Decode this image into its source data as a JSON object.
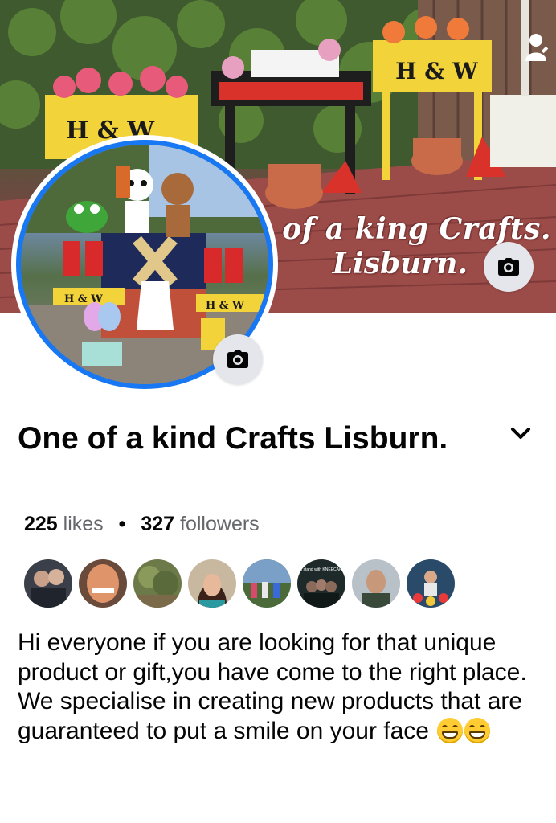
{
  "cover": {
    "sign_text": "H & W",
    "caption_line1": "One of a king Crafts.",
    "caption_line2": "Lisburn.",
    "camera_icon": "camera-icon",
    "user_icon": "user-edit-icon"
  },
  "profile": {
    "camera_icon": "camera-icon",
    "sign_text": "H & W"
  },
  "page": {
    "name": "One of a kind Crafts Lisburn.",
    "likes_count": "225",
    "likes_label": "likes",
    "separator": "•",
    "followers_count": "327",
    "followers_label": "followers",
    "menu_icon": "chevron-down-icon"
  },
  "followers_preview": [
    {
      "name": "follower-1",
      "color": "#3b3f4a"
    },
    {
      "name": "follower-2",
      "color": "#c97a4a"
    },
    {
      "name": "follower-3",
      "color": "#6c7a4a"
    },
    {
      "name": "follower-4",
      "color": "#8a5a3a"
    },
    {
      "name": "follower-5",
      "color": "#4a6a3a"
    },
    {
      "name": "follower-6",
      "color": "#1e2a2a",
      "text": "I stand with KNEECAP"
    },
    {
      "name": "follower-7",
      "color": "#5a6a7a"
    },
    {
      "name": "follower-8",
      "color": "#2a4a6a"
    }
  ],
  "bio": {
    "line1": "Hi everyone if you are looking for that unique product or gift,you have come to the right place.",
    "line2": "We specialise in creating new products that are guaranteed to put a smile on your face",
    "emoji": "grinning-face-icon"
  },
  "colors": {
    "accent": "#1877f2",
    "text": "#050505",
    "muted": "#65676b",
    "button_bg": "#e4e6eb"
  }
}
